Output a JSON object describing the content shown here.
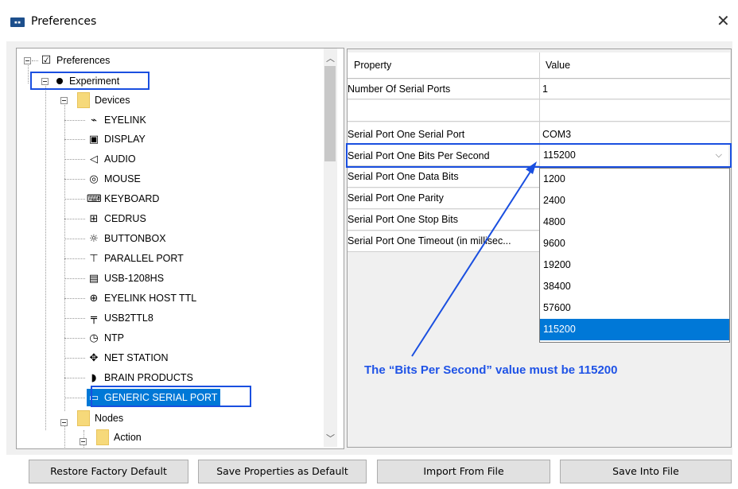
{
  "window": {
    "title": "Preferences",
    "close_icon": "close-icon"
  },
  "tree": {
    "root": "Preferences",
    "experiment": "Experiment",
    "devices": "Devices",
    "device_items": [
      {
        "label": "EYELINK",
        "icon": "eyelink-icon",
        "glyph": "⌁"
      },
      {
        "label": "DISPLAY",
        "icon": "display-icon",
        "glyph": "▣"
      },
      {
        "label": "AUDIO",
        "icon": "audio-icon",
        "glyph": "◁"
      },
      {
        "label": "MOUSE",
        "icon": "mouse-icon",
        "glyph": "◎"
      },
      {
        "label": "KEYBOARD",
        "icon": "keyboard-icon",
        "glyph": "⌨"
      },
      {
        "label": "CEDRUS",
        "icon": "cedrus-icon",
        "glyph": "⊞"
      },
      {
        "label": "BUTTONBOX",
        "icon": "buttonbox-icon",
        "glyph": "☼"
      },
      {
        "label": "PARALLEL PORT",
        "icon": "parallel-port-icon",
        "glyph": "⊤"
      },
      {
        "label": "USB-1208HS",
        "icon": "usb-1208hs-icon",
        "glyph": "▤"
      },
      {
        "label": "EYELINK HOST TTL",
        "icon": "eyelink-host-ttl-icon",
        "glyph": "⊕"
      },
      {
        "label": "USB2TTL8",
        "icon": "usb2ttl8-icon",
        "glyph": "╤"
      },
      {
        "label": "NTP",
        "icon": "ntp-icon",
        "glyph": "◷"
      },
      {
        "label": "NET STATION",
        "icon": "net-station-icon",
        "glyph": "✥"
      },
      {
        "label": "BRAIN PRODUCTS",
        "icon": "brain-products-icon",
        "glyph": "◗"
      },
      {
        "label": "GENERIC SERIAL PORT",
        "icon": "serial-port-icon",
        "glyph": "▭"
      }
    ],
    "nodes": "Nodes",
    "action": "Action"
  },
  "properties": {
    "header_property": "Property",
    "header_value": "Value",
    "rows": [
      {
        "name": "Number Of Serial Ports",
        "value": "1"
      },
      {
        "name": "",
        "value": ""
      },
      {
        "name": "Serial Port One Serial Port",
        "value": "COM3"
      },
      {
        "name": "Serial Port One Bits Per Second",
        "value": "115200"
      },
      {
        "name": "Serial Port One Data Bits",
        "value": ""
      },
      {
        "name": "Serial Port One Parity",
        "value": ""
      },
      {
        "name": "Serial Port One Stop Bits",
        "value": ""
      },
      {
        "name": "Serial Port One Timeout (in millisec...",
        "value": ""
      }
    ]
  },
  "dropdown": {
    "selected": "115200",
    "options": [
      "1200",
      "2400",
      "4800",
      "9600",
      "19200",
      "38400",
      "57600",
      "115200"
    ]
  },
  "annotation": "The “Bits Per Second” value must be 115200",
  "buttons": {
    "restore": "Restore Factory Default",
    "save_default": "Save Properties as Default",
    "import": "Import From File",
    "save_file": "Save Into File"
  },
  "colors": {
    "highlight": "#1a4fe0",
    "selection": "#0078d7",
    "annotation": "#1f53e6"
  }
}
